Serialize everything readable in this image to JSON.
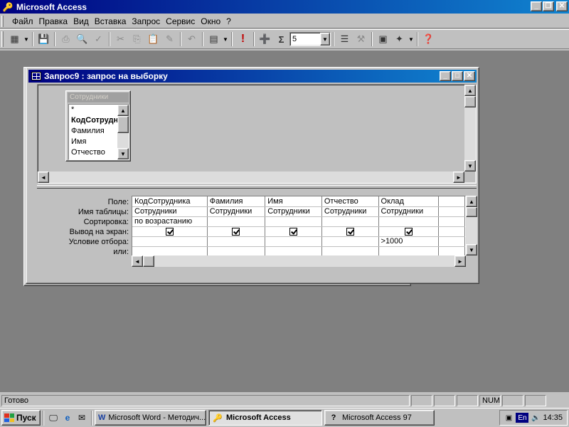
{
  "app": {
    "title": "Microsoft Access"
  },
  "menu": [
    "Файл",
    "Правка",
    "Вид",
    "Вставка",
    "Запрос",
    "Сервис",
    "Окно",
    "?"
  ],
  "toolbar": {
    "top_values": "5"
  },
  "query_window": {
    "title": "Запрос9 : запрос на выборку",
    "field_list": {
      "table": "Сотрудники",
      "fields": [
        "*",
        "КодСотрудника",
        "Фамилия",
        "Имя",
        "Отчество"
      ]
    },
    "grid": {
      "row_labels": [
        "Поле:",
        "Имя таблицы:",
        "Сортировка:",
        "Вывод на экран:",
        "Условие отбора:",
        "или:"
      ],
      "columns": [
        {
          "field": "КодСотрудника",
          "table": "Сотрудники",
          "sort": "по возрастанию",
          "show": true,
          "criteria": ""
        },
        {
          "field": "Фамилия",
          "table": "Сотрудники",
          "sort": "",
          "show": true,
          "criteria": ""
        },
        {
          "field": "Имя",
          "table": "Сотрудники",
          "sort": "",
          "show": true,
          "criteria": ""
        },
        {
          "field": "Отчество",
          "table": "Сотрудники",
          "sort": "",
          "show": true,
          "criteria": ""
        },
        {
          "field": "Оклад",
          "table": "Сотрудники",
          "sort": "",
          "show": true,
          "criteria": ">1000"
        }
      ]
    }
  },
  "status": {
    "text": "Готово",
    "num": "NUM"
  },
  "taskbar": {
    "start": "Пуск",
    "tasks": [
      "Microsoft Word - Методич...",
      "Microsoft Access",
      "Microsoft Access 97"
    ],
    "clock": "14:35",
    "lang": "En"
  }
}
